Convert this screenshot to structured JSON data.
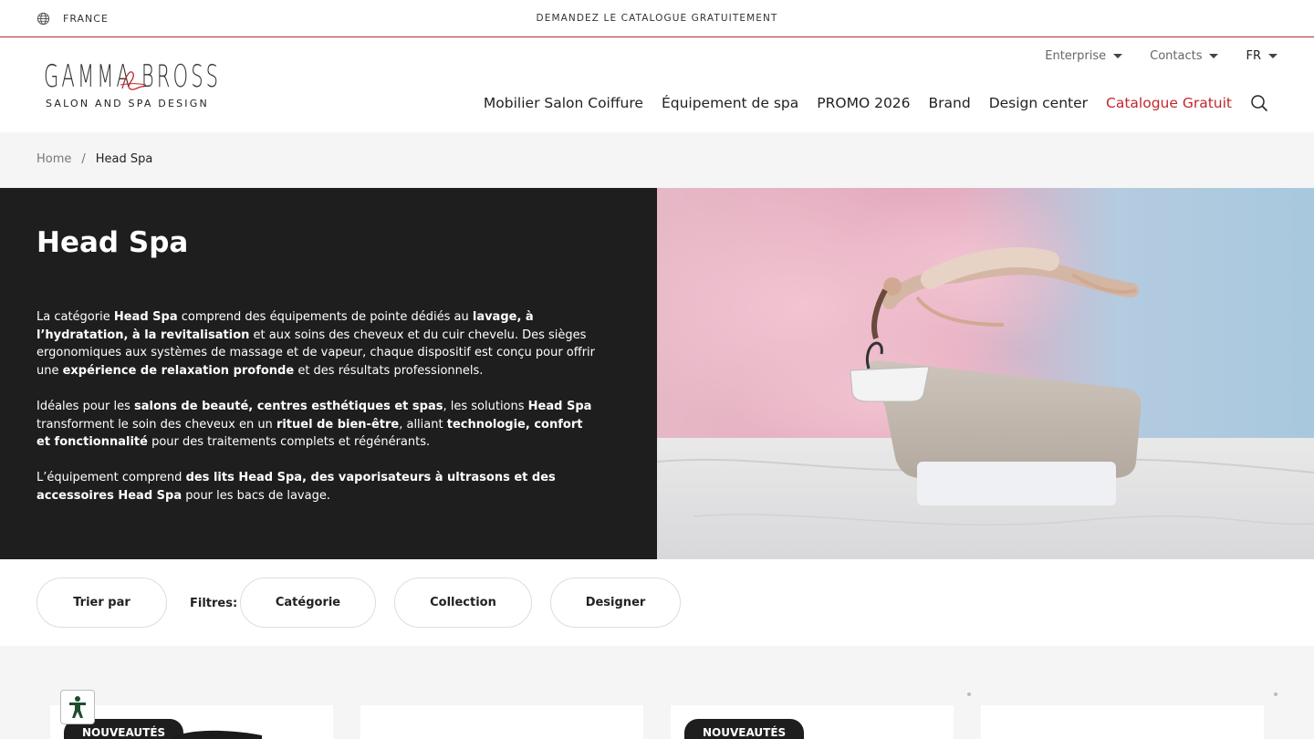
{
  "topbar": {
    "country": "FRANCE",
    "promo": "DEMANDEZ LE CATALOGUE GRATUITEMENT"
  },
  "logo": {
    "wordmark": "GAMMA BROSS",
    "tagline": "SALON AND SPA DESIGN"
  },
  "utility": {
    "enterprise": "Enterprise",
    "contacts": "Contacts",
    "lang": "FR"
  },
  "nav": {
    "items": [
      "Mobilier Salon Coiffure",
      "Équipement de spa",
      "PROMO 2026",
      "Brand",
      "Design center",
      "Catalogue Gratuit"
    ]
  },
  "breadcrumb": {
    "home": "Home",
    "separator": "/",
    "current": "Head Spa"
  },
  "hero": {
    "title": "Head Spa",
    "p1": [
      "La catégorie ",
      "Head Spa",
      " comprend des équipements de pointe dédiés au ",
      "lavage, à l’hydratation, à la revitalisation",
      " et aux soins des cheveux et du cuir chevelu. Des sièges ergonomiques aux systèmes de massage et de vapeur, chaque dispositif est conçu pour offrir une ",
      "expérience de relaxation profonde",
      " et des résultats professionnels."
    ],
    "p2": [
      "Idéales pour les ",
      "salons de beauté, centres esthétiques et spas",
      ", les solutions ",
      "Head Spa",
      " transforment le soin des cheveux en un ",
      "rituel de bien-être",
      ", alliant ",
      "technologie, confort et fonctionnalité",
      " pour des traitements complets et régénérants."
    ],
    "p3": [
      "L’équipement comprend ",
      "des lits Head Spa, des vaporisateurs à ultrasons et des accessoires Head Spa",
      " pour les bacs de lavage."
    ]
  },
  "filters": {
    "sort": "Trier par",
    "label": "Filtres:",
    "category": "Catégorie",
    "collection": "Collection",
    "designer": "Designer"
  },
  "products": {
    "badge": "NOUVEAUTÉS"
  },
  "colors": {
    "accent_red": "#c0272d",
    "dark": "#1e1e1e"
  }
}
